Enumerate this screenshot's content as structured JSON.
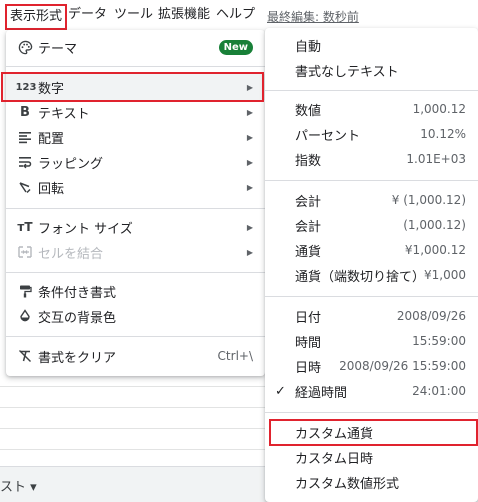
{
  "menubar": {
    "items": [
      "表示形式",
      "データ",
      "ツール",
      "拡張機能",
      "ヘルプ"
    ],
    "last_edit": "最終編集: 数秒前"
  },
  "sheet_tab_label": "スト ▾",
  "format_menu": {
    "theme": {
      "label": "テーマ",
      "badge": "New",
      "icon": "palette-icon"
    },
    "number": {
      "label": "数字",
      "icon_text": "123"
    },
    "text": {
      "label": "テキスト",
      "icon_text": "B"
    },
    "align": {
      "label": "配置",
      "icon": "align-left-icon"
    },
    "wrap": {
      "label": "ラッピング",
      "icon": "text-wrap-icon"
    },
    "rotate": {
      "label": "回転",
      "icon": "text-rotation-icon"
    },
    "font_size": {
      "label": "フォント サイズ",
      "icon": "font-size-icon"
    },
    "merge": {
      "label": "セルを結合",
      "icon": "merge-icon"
    },
    "conditional": {
      "label": "条件付き書式",
      "icon": "paint-roller-icon"
    },
    "alternating": {
      "label": "交互の背景色",
      "icon": "fill-drip-icon"
    },
    "clear": {
      "label": "書式をクリア",
      "shortcut": "Ctrl+\\",
      "icon": "clear-format-icon"
    }
  },
  "number_menu": {
    "auto": "自動",
    "plain": "書式なしテキスト",
    "rows1": [
      {
        "label": "数値",
        "value": "1,000.12"
      },
      {
        "label": "パーセント",
        "value": "10.12%"
      },
      {
        "label": "指数",
        "value": "1.01E+03"
      }
    ],
    "rows2": [
      {
        "label": "会計",
        "value": "¥ (1,000.12)"
      },
      {
        "label": "会計",
        "value": "(1,000.12)"
      },
      {
        "label": "通貨",
        "value": "¥1,000.12"
      },
      {
        "label": "通貨（端数切り捨て）",
        "value": "¥1,000"
      }
    ],
    "rows3": [
      {
        "label": "日付",
        "value": "2008/09/26"
      },
      {
        "label": "時間",
        "value": "15:59:00"
      },
      {
        "label": "日時",
        "value": "2008/09/26 15:59:00"
      },
      {
        "label": "経過時間",
        "value": "24:01:00",
        "checked": true
      }
    ],
    "custom_currency": "カスタム通貨",
    "custom_datetime": "カスタム日時",
    "custom_number": "カスタム数値形式"
  },
  "colors": {
    "accent_red": "#e0232e",
    "badge_green": "#188038"
  }
}
